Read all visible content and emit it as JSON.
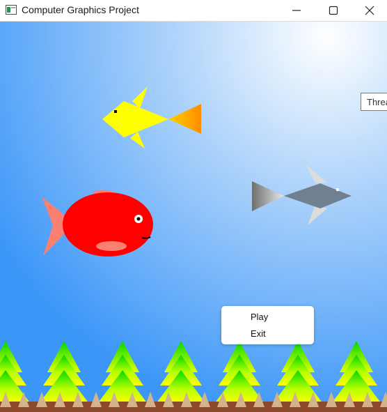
{
  "window": {
    "title": "Computer Graphics Project",
    "controls": [
      "minimize-icon",
      "maximize-icon",
      "close-icon"
    ]
  },
  "scene": {
    "thread_label": "Threa",
    "colors": {
      "water_top": "#eaf3fd",
      "water_bottom": "#3b96f8",
      "yellow_fish": "#ffff00",
      "red_fish": "#ff0000",
      "grey_fish": "#708090",
      "tree_green": "#00e000",
      "tree_yellow": "#ffff00",
      "seabed": "#8b4a2b"
    },
    "tree_count": 7
  },
  "context_menu": {
    "items": [
      {
        "label": "Play"
      },
      {
        "label": "Exit"
      }
    ]
  }
}
